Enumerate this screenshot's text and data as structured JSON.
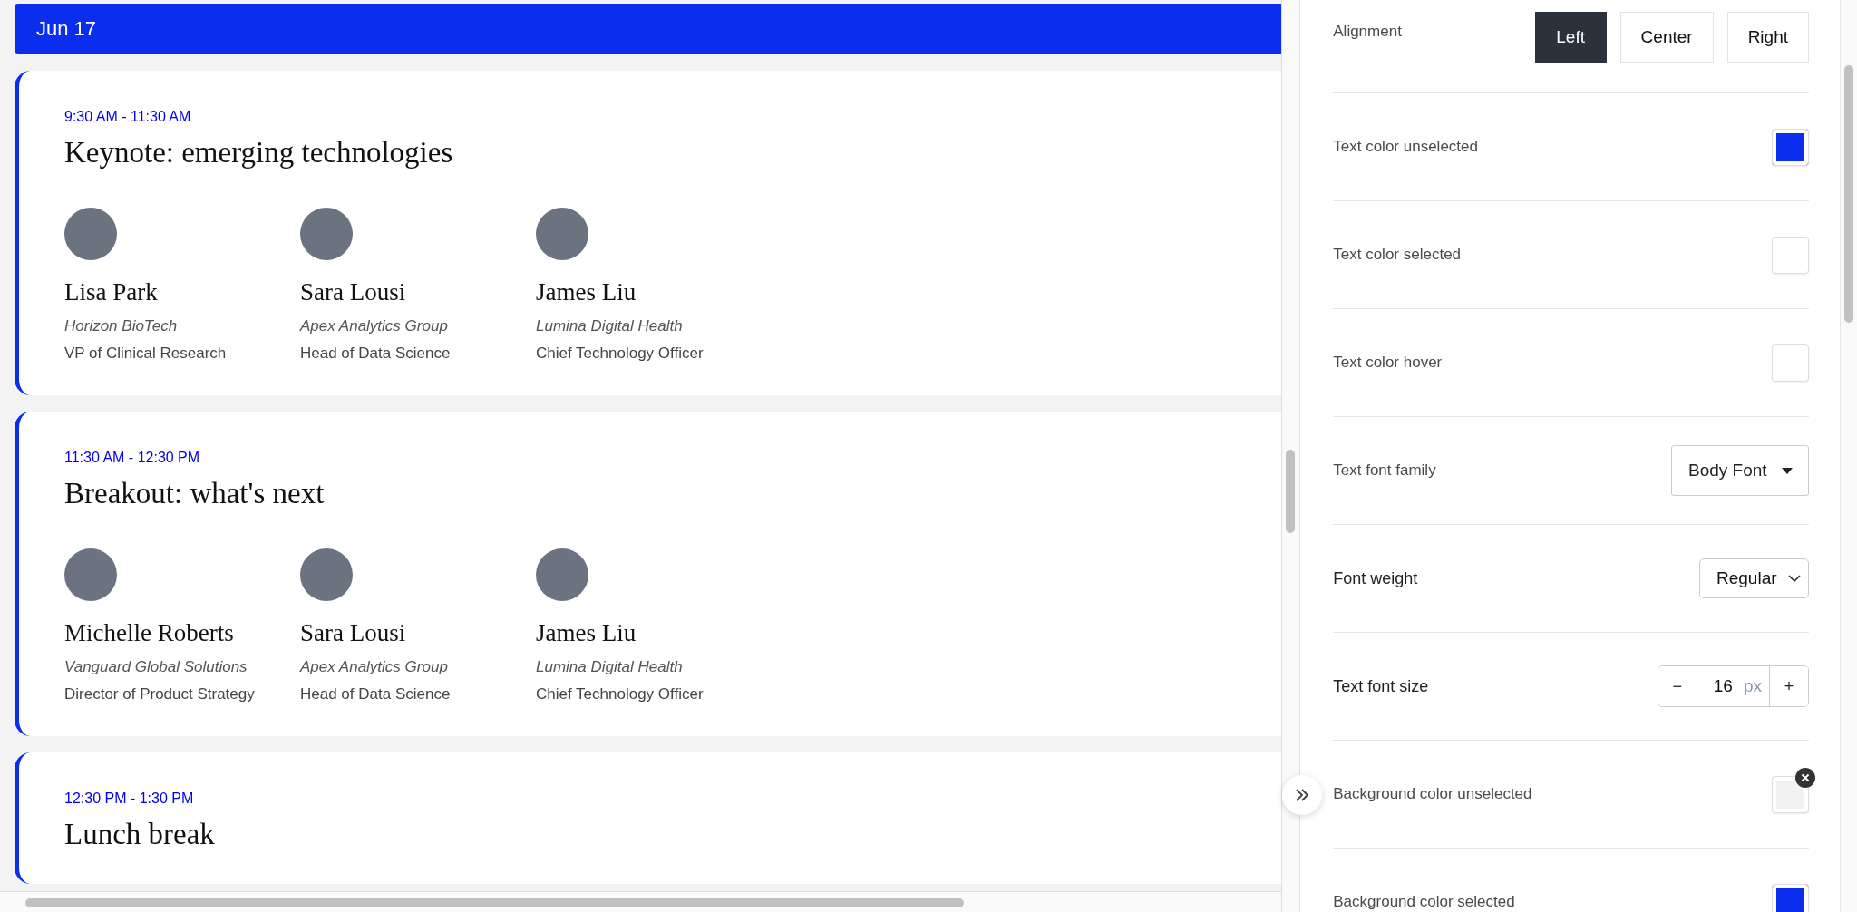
{
  "schedule": {
    "date": "Jun 17",
    "sessions": [
      {
        "time": "9:30 AM - 11:30 AM",
        "title": "Keynote: emerging technologies",
        "speakers": [
          {
            "name": "Lisa Park",
            "company": "Horizon BioTech",
            "role": "VP of Clinical Research"
          },
          {
            "name": "Sara Lousi",
            "company": "Apex Analytics Group",
            "role": "Head of Data Science"
          },
          {
            "name": "James Liu",
            "company": "Lumina Digital Health",
            "role": "Chief Technology Officer"
          }
        ]
      },
      {
        "time": "11:30 AM - 12:30 PM",
        "title": "Breakout: what's next",
        "speakers": [
          {
            "name": "Michelle Roberts",
            "company": "Vanguard Global Solutions",
            "role": "Director of Product Strategy"
          },
          {
            "name": "Sara Lousi",
            "company": "Apex Analytics Group",
            "role": "Head of Data Science"
          },
          {
            "name": "James Liu",
            "company": "Lumina Digital Health",
            "role": "Chief Technology Officer"
          }
        ]
      },
      {
        "time": "12:30 PM - 1:30 PM",
        "title": "Lunch break"
      }
    ]
  },
  "settings": [
    {
      "kind": "segmented",
      "label": "Alignment",
      "options": [
        {
          "label": "Left",
          "selected": true
        },
        {
          "label": "Center",
          "selected": false
        },
        {
          "label": "Right",
          "selected": false
        }
      ]
    },
    {
      "kind": "color",
      "label": "Text color unselected",
      "color": "#0b2ded"
    },
    {
      "kind": "color",
      "label": "Text color selected",
      "color": "#ffffff"
    },
    {
      "kind": "color",
      "label": "Text color hover",
      "color": "#ffffff"
    },
    {
      "kind": "dropdown",
      "label": "Text font family",
      "value": "Body Font"
    },
    {
      "kind": "select",
      "label": "Font weight",
      "value": "Regular"
    },
    {
      "kind": "stepper",
      "label": "Text font size",
      "minus": "−",
      "value": "16",
      "unit": "px",
      "plus": "+"
    },
    {
      "kind": "color",
      "label": "Background color unselected",
      "color": "#f2f2f2",
      "clearable": true
    },
    {
      "kind": "color",
      "label": "Background color selected",
      "color": "#0b2ded"
    }
  ]
}
